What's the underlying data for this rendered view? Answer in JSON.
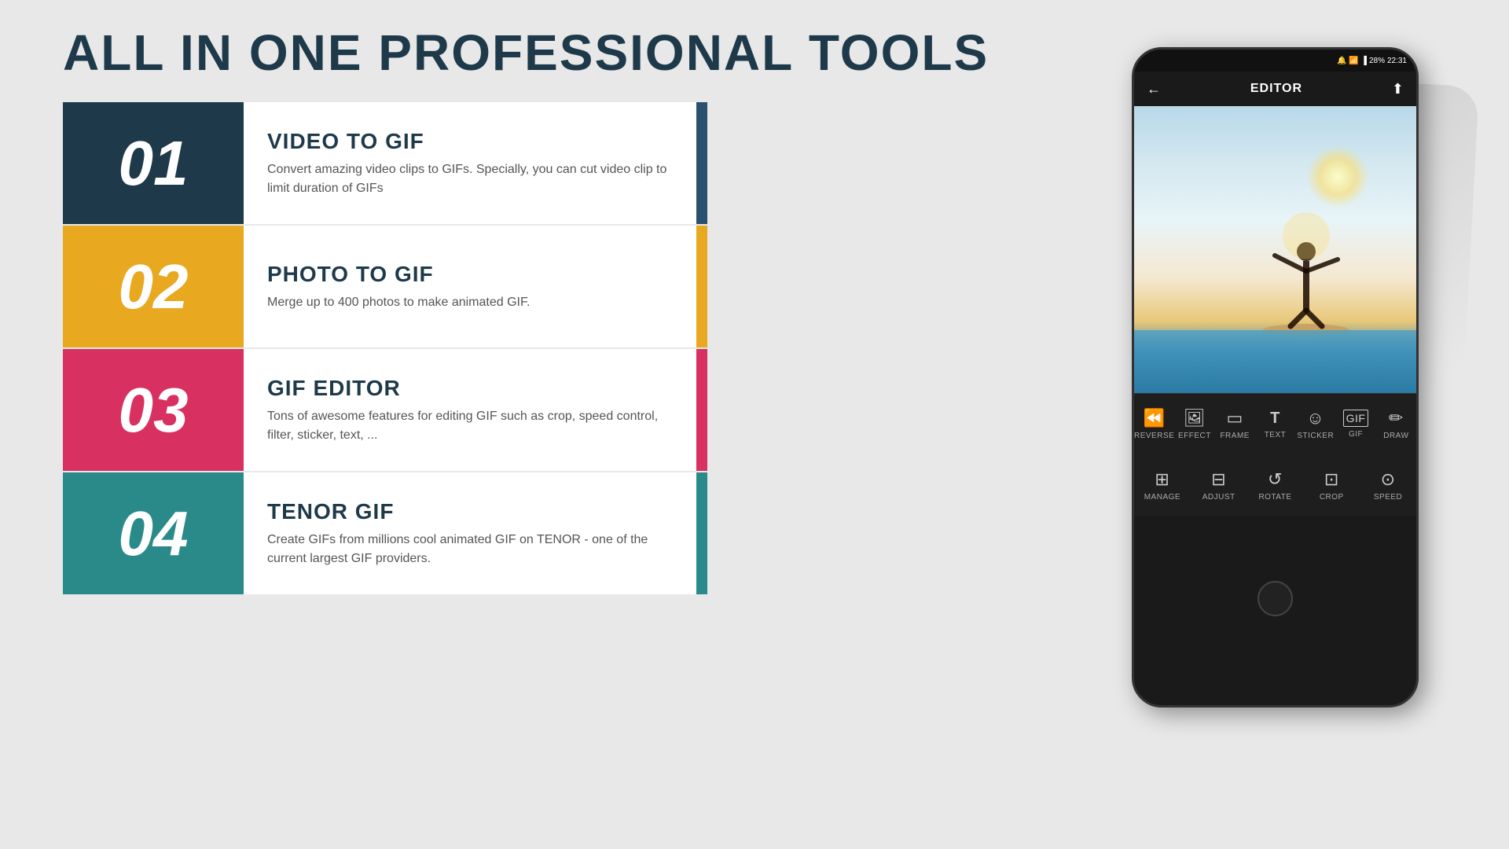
{
  "header": {
    "title": "ALL IN ONE PROFESSIONAL TOOLS"
  },
  "features": [
    {
      "number": "01",
      "title": "VIDEO TO GIF",
      "description": "Convert amazing video clips to GIFs. Specially, you can cut video clip to limit duration of GIFs",
      "color_class": "row-1"
    },
    {
      "number": "02",
      "title": "PHOTO TO GIF",
      "description": "Merge up to 400 photos to make animated GIF.",
      "color_class": "row-2"
    },
    {
      "number": "03",
      "title": "GIF EDITOR",
      "description": "Tons of awesome features for editing GIF such as  crop, speed control, filter, sticker, text, ...",
      "color_class": "row-3"
    },
    {
      "number": "04",
      "title": "TENOR GIF",
      "description": "Create GIFs from millions cool animated GIF on TENOR - one of the current largest GIF providers.",
      "color_class": "row-4"
    }
  ],
  "phone": {
    "status_bar": {
      "battery": "28%",
      "time": "22:31"
    },
    "editor": {
      "title": "EDITOR"
    },
    "toolbar_row1": [
      {
        "icon": "⏪",
        "label": "REVERSE"
      },
      {
        "icon": "✦",
        "label": "EFFECT"
      },
      {
        "icon": "▢",
        "label": "FRAME"
      },
      {
        "icon": "T",
        "label": "TEXT"
      },
      {
        "icon": "☺",
        "label": "STICKER"
      },
      {
        "icon": "GIF",
        "label": "GIF"
      },
      {
        "icon": "✏",
        "label": "DRAW"
      }
    ],
    "toolbar_row2": [
      {
        "icon": "⊞",
        "label": "MANAGE"
      },
      {
        "icon": "⊟",
        "label": "ADJUST"
      },
      {
        "icon": "↺",
        "label": "ROTATE"
      },
      {
        "icon": "⊡",
        "label": "CROP"
      },
      {
        "icon": "⊙",
        "label": "SPEED"
      }
    ]
  }
}
